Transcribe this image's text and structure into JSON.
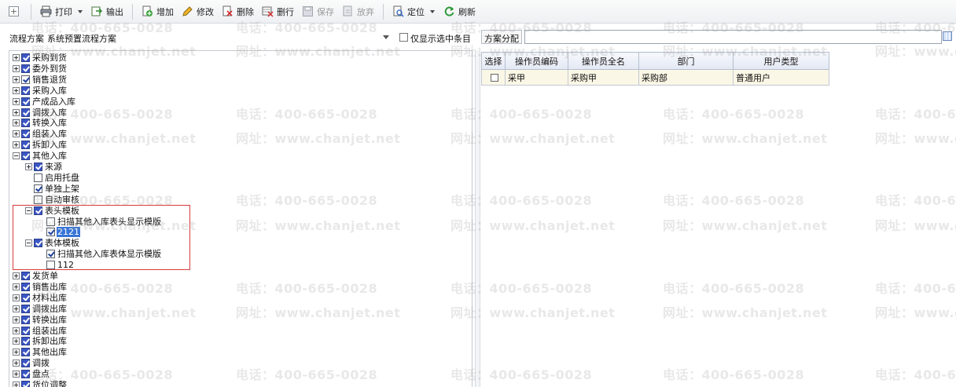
{
  "toolbar": {
    "add_label": "",
    "print": "打印",
    "export": "输出",
    "add": "增加",
    "edit": "修改",
    "delete": "删除",
    "delete_row": "删行",
    "save": "保存",
    "discard": "放弃",
    "locate": "定位",
    "refresh": "刷新"
  },
  "options": {
    "scheme_label": "流程方案",
    "scheme_value": "系统预置流程方案",
    "only_selected_label": "仅显示选中条目",
    "assign_label": "方案分配"
  },
  "tree": [
    {
      "label": "采购到货",
      "level": 0,
      "exp": "plus",
      "check": "partial"
    },
    {
      "label": "委外到货",
      "level": 0,
      "exp": "plus",
      "check": "partial"
    },
    {
      "label": "销售退货",
      "level": 0,
      "exp": "plus",
      "check": "on"
    },
    {
      "label": "采购入库",
      "level": 0,
      "exp": "plus",
      "check": "partial"
    },
    {
      "label": "产成品入库",
      "level": 0,
      "exp": "plus",
      "check": "partial"
    },
    {
      "label": "调拨入库",
      "level": 0,
      "exp": "plus",
      "check": "partial"
    },
    {
      "label": "转换入库",
      "level": 0,
      "exp": "plus",
      "check": "partial"
    },
    {
      "label": "组装入库",
      "level": 0,
      "exp": "plus",
      "check": "partial"
    },
    {
      "label": "拆卸入库",
      "level": 0,
      "exp": "plus",
      "check": "partial"
    },
    {
      "label": "其他入库",
      "level": 0,
      "exp": "minus",
      "check": "partial"
    },
    {
      "label": "来源",
      "level": 1,
      "exp": "plus",
      "check": "partial"
    },
    {
      "label": "启用托盘",
      "level": 1,
      "exp": "none",
      "check": "off"
    },
    {
      "label": "单独上架",
      "level": 1,
      "exp": "none",
      "check": "on"
    },
    {
      "label": "自动审核",
      "level": 1,
      "exp": "none",
      "check": "off"
    },
    {
      "label": "表头模板",
      "level": 1,
      "exp": "minus",
      "check": "partial"
    },
    {
      "label": "扫描其他入库表头显示模版",
      "level": 2,
      "exp": "none",
      "check": "off"
    },
    {
      "label": "2121",
      "level": 2,
      "exp": "none",
      "check": "on",
      "selected": true
    },
    {
      "label": "表体模板",
      "level": 1,
      "exp": "minus",
      "check": "partial"
    },
    {
      "label": "扫描其他入库表体显示模版",
      "level": 2,
      "exp": "none",
      "check": "on"
    },
    {
      "label": "112",
      "level": 2,
      "exp": "none",
      "check": "off"
    },
    {
      "label": "发货单",
      "level": 0,
      "exp": "plus",
      "check": "partial"
    },
    {
      "label": "销售出库",
      "level": 0,
      "exp": "plus",
      "check": "partial"
    },
    {
      "label": "材料出库",
      "level": 0,
      "exp": "plus",
      "check": "partial"
    },
    {
      "label": "调拨出库",
      "level": 0,
      "exp": "plus",
      "check": "partial"
    },
    {
      "label": "转换出库",
      "level": 0,
      "exp": "plus",
      "check": "partial"
    },
    {
      "label": "组装出库",
      "level": 0,
      "exp": "plus",
      "check": "partial"
    },
    {
      "label": "拆卸出库",
      "level": 0,
      "exp": "plus",
      "check": "partial"
    },
    {
      "label": "其他出库",
      "level": 0,
      "exp": "plus",
      "check": "partial"
    },
    {
      "label": "调拨",
      "level": 0,
      "exp": "plus",
      "check": "partial"
    },
    {
      "label": "盘点",
      "level": 0,
      "exp": "plus",
      "check": "partial"
    },
    {
      "label": "货位调整",
      "level": 0,
      "exp": "plus",
      "check": "partial"
    }
  ],
  "table": {
    "headers": [
      "选择",
      "操作员编码",
      "操作员全名",
      "部门",
      "用户类型"
    ],
    "rows": [
      [
        "",
        "采甲",
        "采购甲",
        "采购部",
        "普通用户"
      ]
    ]
  },
  "watermark": {
    "phone": "电话：400-665-0028",
    "site": "网址：www.chanjet.net"
  },
  "colors": {
    "highlight_box": "#d63b3b",
    "selected_node": "#3875d7",
    "row_bg": "#fbf7e6"
  }
}
